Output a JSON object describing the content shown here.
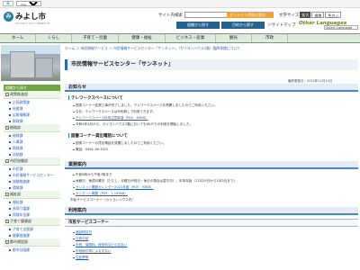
{
  "util": {
    "translate_label": "Select Language"
  },
  "header": {
    "logo_mark": "み",
    "site_name": "みよし市",
    "site_sub": "MIYOSHI CITY WEBSITE",
    "search_label": "サイト内検索",
    "search_placeholder": "",
    "search_btn": "検索",
    "ask_btn": "オンライン手続き案内",
    "fontsize_label": "文字サイズ",
    "fs_large": "拡大",
    "fs_std": "標準",
    "fs_color": "色合い",
    "find_btn1": "組織から探す",
    "find_btn2": "目的から探す",
    "sitemap": "＞サイトマップ",
    "other_lang": "Other Languages",
    "lang_select": "Select Language"
  },
  "nav": [
    "ホーム",
    "くらし",
    "子育て・児童",
    "健康・福祉",
    "ビジネス・産業",
    "観光",
    "市政"
  ],
  "breadcrumb": "ホーム ＞ 市民情報サービス ＞ 市民情報サービスセンター「サンネット」（カリヨンハウス2階）臨時休館について",
  "left": {
    "menu_head": "組織から探す",
    "menu": [
      {
        "cat": "政策推進部",
        "subs": [
          "企画政策課",
          "秘書課",
          "広報情報課",
          "財政課"
        ]
      },
      {
        "cat": "総務部",
        "subs": [
          "総務課",
          "人事課",
          "税務課",
          "収納課"
        ]
      },
      {
        "cat": "市民協働部",
        "subs": [
          "市民課",
          "市民情報サービスセンター",
          "協働推進課",
          "環境課"
        ]
      },
      {
        "cat": "福祉部",
        "subs": [
          "福祉課",
          "長寿介護課",
          "保険年金課"
        ]
      },
      {
        "cat": "子育て健康部",
        "subs": [
          "子育て支援課",
          "健康推進課"
        ]
      },
      {
        "cat": "都市建設部",
        "subs": [
          "都市計画課"
        ]
      }
    ]
  },
  "main": {
    "title": "市民情報サービスセンター「サンネット」",
    "updated": "最終更新日：2022年12月14日",
    "sec1": "お知らせ",
    "telework_head": "テレワークスペースについて",
    "telework_items": [
      "図書コーナー拡張工事が完了しました。テレワークスペースを再開しましたのでご利用ください。",
      "なお、テレワークスペースは予約無しで利用できます。",
      "テレワークスペース利用注意事項（PDF：89KB）",
      "令和4年4月から、カリヨンハウス2階においてもWi-Fiでの利用を開始しました。"
    ],
    "library_head": "図書コーナー貸出電話について",
    "library_items": [
      "図書コーナーの貸出電話を設置しましたのでご利用ください。",
      "電話：0561-36-3322"
    ],
    "sec2": "業務案内",
    "hours_items": [
      "午前9時から午後7時まで",
      "休館日：毎週月曜日（ただし、月曜日が祝日・休日の場合は翌平日）、年末年始（12月29日から1月3日まで）",
      "サンネット開館カレンダー2022年度（PDF：93KB）",
      "サンネット概要（PDF：1,199KB）"
    ],
    "extra_line": "市民サービスコーナー（カリヨンハウス内）",
    "sec3": "利用案内",
    "rl_head": "市民サービスコーナー",
    "rl_items": [
      "諸証明交付",
      "行政手続",
      "市税、保険料、使用料などの支払い",
      "市税納付書による支払い",
      "住民票等"
    ]
  }
}
